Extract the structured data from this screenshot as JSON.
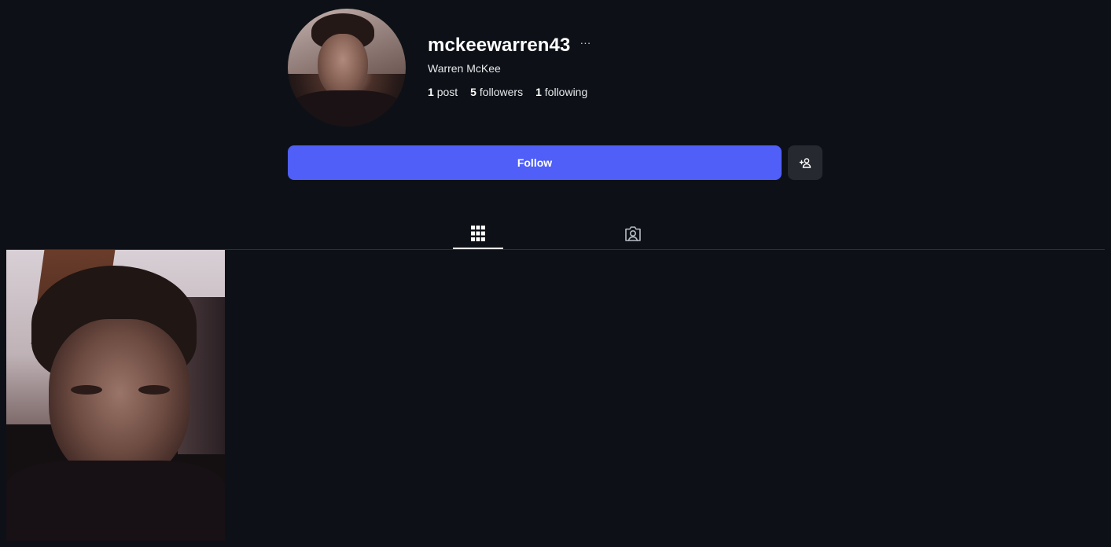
{
  "profile": {
    "username": "mckeewarren43",
    "more_label": "···",
    "full_name": "Warren McKee",
    "stats": {
      "posts_count": "1",
      "posts_label": "post",
      "followers_count": "5",
      "followers_label": "followers",
      "following_count": "1",
      "following_label": "following"
    }
  },
  "actions": {
    "follow_label": "Follow",
    "add_user_icon": "add-user-icon"
  },
  "tabs": [
    {
      "name": "posts",
      "icon": "grid-icon",
      "active": true
    },
    {
      "name": "tagged",
      "icon": "tagged-user-icon",
      "active": false
    }
  ],
  "colors": {
    "background": "#0d1117",
    "accent": "#4f5ff7",
    "secondary_button": "#262a30",
    "divider": "#2c3138"
  },
  "posts": [
    {
      "type": "photo"
    }
  ]
}
